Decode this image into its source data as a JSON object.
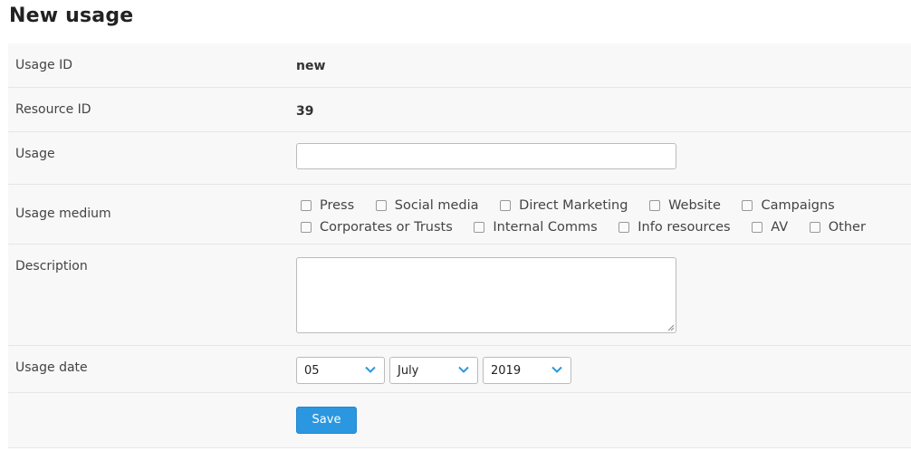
{
  "page": {
    "title": "New usage"
  },
  "fields": {
    "usage_id": {
      "label": "Usage ID",
      "value": "new"
    },
    "resource_id": {
      "label": "Resource ID",
      "value": "39"
    },
    "usage": {
      "label": "Usage",
      "value": "",
      "placeholder": ""
    },
    "usage_medium": {
      "label": "Usage medium",
      "options": [
        {
          "label": "Press",
          "checked": false
        },
        {
          "label": "Social media",
          "checked": false
        },
        {
          "label": "Direct Marketing",
          "checked": false
        },
        {
          "label": "Website",
          "checked": false
        },
        {
          "label": "Campaigns",
          "checked": false
        },
        {
          "label": "Corporates or Trusts",
          "checked": false
        },
        {
          "label": "Internal Comms",
          "checked": false
        },
        {
          "label": "Info resources",
          "checked": false
        },
        {
          "label": "AV",
          "checked": false
        },
        {
          "label": "Other",
          "checked": false
        }
      ]
    },
    "description": {
      "label": "Description",
      "value": ""
    },
    "usage_date": {
      "label": "Usage date",
      "day": "05",
      "month": "July",
      "year": "2019"
    }
  },
  "actions": {
    "save_label": "Save"
  },
  "colors": {
    "accent": "#2b97e1",
    "chevron": "#2b97e1",
    "row_tint": "#f8f8f8"
  }
}
